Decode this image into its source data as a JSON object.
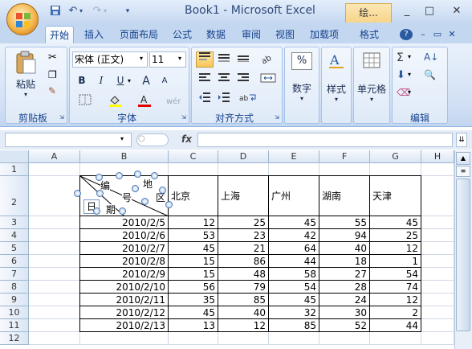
{
  "window": {
    "title": "Book1 - Microsoft Excel",
    "context_tab": "绘...",
    "minimize": "_",
    "restore": "□",
    "close": "✕"
  },
  "quick_access": [
    "save-icon",
    "undo-icon",
    "redo-icon"
  ],
  "tabs": [
    "开始",
    "插入",
    "页面布局",
    "公式",
    "数据",
    "审阅",
    "视图",
    "加载项",
    "格式"
  ],
  "ribbon": {
    "clipboard": {
      "paste": "粘贴",
      "label": "剪贴板"
    },
    "font": {
      "name": "宋体 (正文)",
      "size": "11",
      "bold": "B",
      "italic": "I",
      "underline": "U",
      "grow": "A",
      "shrink": "A",
      "label": "字体"
    },
    "alignment": {
      "label": "对齐方式"
    },
    "number": {
      "btn": "数字",
      "icon": "%"
    },
    "styles": {
      "btn": "样式"
    },
    "cells": {
      "btn": "单元格"
    },
    "editing": {
      "label": "编辑"
    }
  },
  "formula_bar": {
    "name_box": "",
    "fx": "fx",
    "value": ""
  },
  "columns": [
    "A",
    "B",
    "C",
    "D",
    "E",
    "F",
    "G",
    "H"
  ],
  "rows": [
    "1",
    "2",
    "3",
    "4",
    "5",
    "6",
    "7",
    "8",
    "9",
    "10",
    "11",
    "12"
  ],
  "header_diag": {
    "bian": "编",
    "hao": "号",
    "ri": "日",
    "qi": "期",
    "di": "地",
    "qu": "区"
  },
  "city_headers": [
    "北京",
    "上海",
    "广州",
    "湖南",
    "天津"
  ],
  "table": [
    {
      "date": "2010/2/5",
      "v": [
        "12",
        "25",
        "45",
        "55",
        "45"
      ]
    },
    {
      "date": "2010/2/6",
      "v": [
        "53",
        "23",
        "42",
        "94",
        "25"
      ]
    },
    {
      "date": "2010/2/7",
      "v": [
        "45",
        "21",
        "64",
        "40",
        "12"
      ]
    },
    {
      "date": "2010/2/8",
      "v": [
        "15",
        "86",
        "44",
        "18",
        "1"
      ]
    },
    {
      "date": "2010/2/9",
      "v": [
        "15",
        "48",
        "58",
        "27",
        "54"
      ]
    },
    {
      "date": "2010/2/10",
      "v": [
        "56",
        "79",
        "54",
        "28",
        "74"
      ]
    },
    {
      "date": "2010/2/11",
      "v": [
        "35",
        "85",
        "45",
        "24",
        "12"
      ]
    },
    {
      "date": "2010/2/12",
      "v": [
        "45",
        "40",
        "32",
        "30",
        "2"
      ]
    },
    {
      "date": "2010/2/13",
      "v": [
        "13",
        "12",
        "85",
        "52",
        "44"
      ]
    }
  ]
}
